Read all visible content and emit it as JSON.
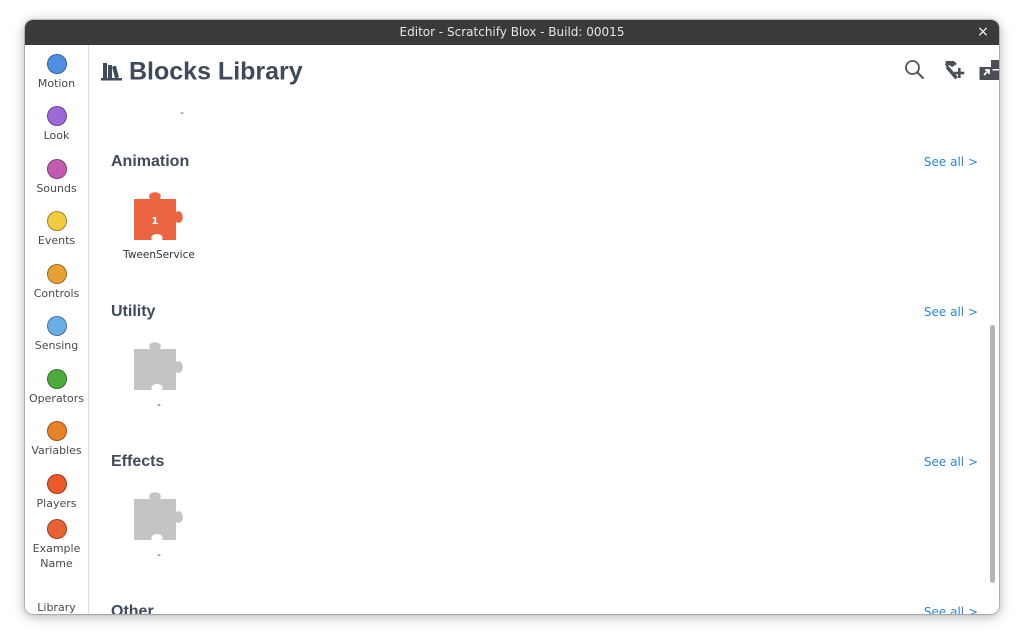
{
  "window": {
    "title": "Editor - Scratchify Blox - Build: 00015",
    "close_label": "×"
  },
  "sidebar": {
    "items": [
      {
        "label": "Motion",
        "color": "#4d8fe0"
      },
      {
        "label": "Look",
        "color": "#9a6bd8"
      },
      {
        "label": "Sounds",
        "color": "#c25bb0"
      },
      {
        "label": "Events",
        "color": "#f2cc3e"
      },
      {
        "label": "Controls",
        "color": "#e8a033"
      },
      {
        "label": "Sensing",
        "color": "#6aaee6"
      },
      {
        "label": "Operators",
        "color": "#4fab3c"
      },
      {
        "label": "Variables",
        "color": "#e88228"
      },
      {
        "label": "Players",
        "color": "#ec5a2a"
      },
      {
        "label": "Example Name",
        "color": "#e96035"
      }
    ],
    "library_label": "Library"
  },
  "header": {
    "title": "Blocks Library",
    "top_dash": "-"
  },
  "toolbar": {
    "icons": [
      "search-icon",
      "hammer-plus-icon",
      "blocks-import-icon"
    ]
  },
  "sections": [
    {
      "title": "Animation",
      "see_all": "See all >",
      "block": {
        "label": "TweenService",
        "badge": "1",
        "color": "#ea6540"
      }
    },
    {
      "title": "Utility",
      "see_all": "See all >",
      "block": {
        "label": "-",
        "color": "#c4c4c4"
      }
    },
    {
      "title": "Effects",
      "see_all": "See all >",
      "block": {
        "label": "-",
        "color": "#c4c4c4"
      }
    },
    {
      "title": "Other",
      "see_all": "See all >"
    }
  ]
}
